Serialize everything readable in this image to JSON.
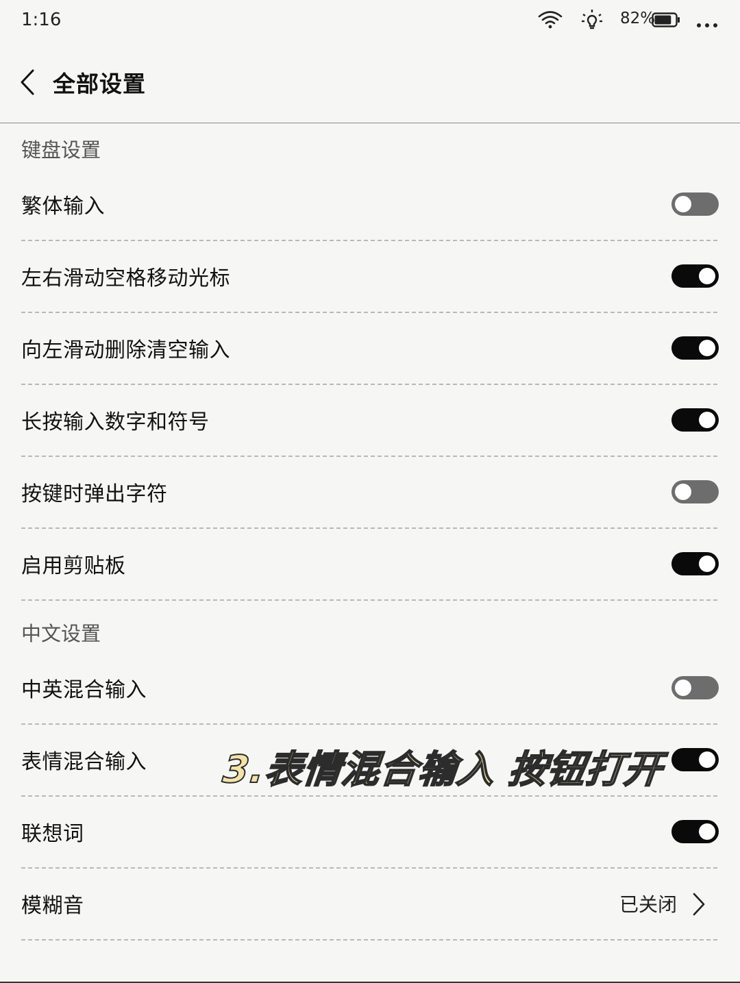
{
  "status_bar": {
    "time": "1:16",
    "battery_percent": "82%",
    "battery_level": 0.82,
    "icons": [
      "wifi-icon",
      "brightness-icon",
      "battery-icon",
      "more-icon"
    ]
  },
  "header": {
    "back_icon": "chevron-left-icon",
    "title": "全部设置"
  },
  "sections": {
    "keyboard": {
      "title": "键盘设置"
    },
    "chinese": {
      "title": "中文设置"
    }
  },
  "rows": {
    "traditional": {
      "label": "繁体输入",
      "enabled": false
    },
    "swipe_cursor": {
      "label": "左右滑动空格移动光标",
      "enabled": true
    },
    "swipe_delete": {
      "label": "向左滑动删除清空输入",
      "enabled": true
    },
    "long_press": {
      "label": "长按输入数字和符号",
      "enabled": true
    },
    "key_popup": {
      "label": "按键时弹出字符",
      "enabled": false
    },
    "clipboard": {
      "label": "启用剪贴板",
      "enabled": true
    },
    "mixed_en": {
      "label": "中英混合输入",
      "enabled": false
    },
    "mixed_emoji": {
      "label": "表情混合输入",
      "enabled": true
    },
    "prediction": {
      "label": "联想词",
      "enabled": true
    },
    "fuzzy": {
      "label": "模糊音",
      "value": "已关闭"
    }
  },
  "caption": "3.表情混合输入 按钮打开",
  "colors": {
    "background": "#f6f6f4",
    "toggle_on": "#0a0a0a",
    "toggle_off": "#6d6d6d",
    "caption_fill": "#f4e3a6"
  }
}
